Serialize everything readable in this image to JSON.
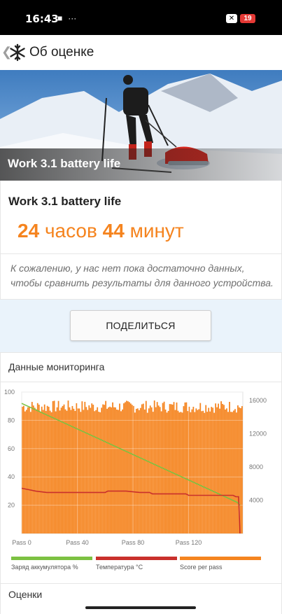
{
  "status_bar": {
    "time": "16:43",
    "notification_icons": [
      "sim-card-icon",
      "more-dots-icon"
    ],
    "battery_level": "19"
  },
  "app_bar": {
    "title": "Об оценке",
    "logo_icon": "snowflake-icon"
  },
  "hero": {
    "caption": "Work 3.1 battery life"
  },
  "result": {
    "test_name": "Work 3.1 battery life",
    "hours_value": "24",
    "hours_unit": "часов",
    "minutes_value": "44",
    "minutes_unit": "минут",
    "note": "К сожалению, у нас нет пока достаточно данных, чтобы сравнить результаты для данного устройства."
  },
  "share": {
    "label": "ПОДЕЛИТЬСЯ"
  },
  "monitoring": {
    "title": "Данные мониторинга"
  },
  "ratings": {
    "title": "Оценки"
  },
  "colors": {
    "accent_orange": "#f5841f",
    "battery_green": "#7cc142",
    "temperature_red": "#c9302c",
    "score_orange": "#f5841f",
    "share_bg": "#eaf3fb"
  },
  "chart_data": {
    "type": "area",
    "x_ticks": [
      "Pass 0",
      "Pass 40",
      "Pass 80",
      "Pass 120"
    ],
    "x_range": [
      0,
      159
    ],
    "left_axis": {
      "ticks": [
        "100",
        "80",
        "60",
        "40",
        "20"
      ],
      "range": [
        0,
        100
      ]
    },
    "right_axis": {
      "ticks": [
        "16000",
        "12000",
        "8000",
        "4000"
      ],
      "range": [
        0,
        17000
      ]
    },
    "series": [
      {
        "name": "Заряд аккумулятора %",
        "color": "#7cc142",
        "type": "line",
        "axis": "left",
        "x": [
          0,
          155,
          157
        ],
        "values": [
          92,
          22,
          20
        ]
      },
      {
        "name": "Температура °C",
        "color": "#c9302c",
        "type": "line",
        "axis": "left",
        "x": [
          0,
          5,
          10,
          18,
          40,
          60,
          62,
          75,
          85,
          92,
          94,
          118,
          120,
          135,
          150,
          152,
          154,
          156,
          157
        ],
        "values": [
          32,
          31,
          30,
          29,
          29,
          29,
          30,
          30,
          29,
          29,
          28,
          28,
          27,
          27,
          27,
          27,
          26,
          26,
          0
        ]
      },
      {
        "name": "Score per pass",
        "color": "#f5841f",
        "type": "bar",
        "axis": "right",
        "x_range": [
          0,
          158
        ],
        "value_mean": 15200,
        "value_range": [
          14500,
          16000
        ]
      }
    ]
  }
}
